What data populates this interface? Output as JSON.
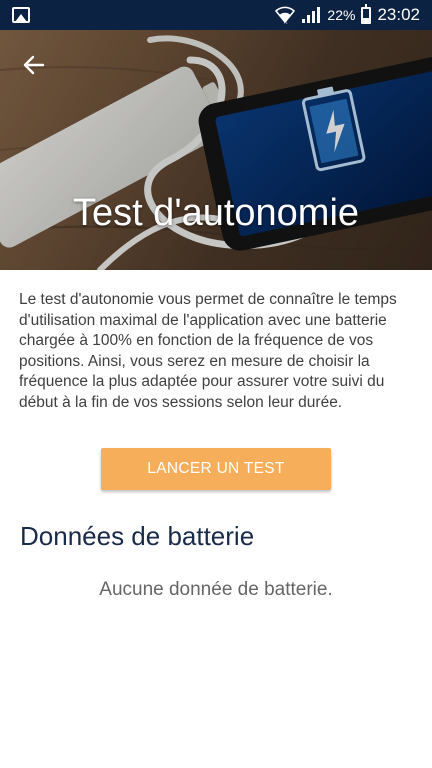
{
  "status_bar": {
    "battery_percent": "22%",
    "time": "23:02"
  },
  "header": {
    "title": "Test d'autonomie"
  },
  "description": "Le test d'autonomie vous permet de connaître le temps d'utilisation maximal de l'application avec une batterie chargée à 100% en fonction de la fréquence de vos positions. Ainsi, vous serez en mesure de choisir la fréquence la plus adaptée pour assurer votre suivi du début à la fin de vos sessions selon leur durée.",
  "actions": {
    "test_button_label": "LANCER UN TEST"
  },
  "battery_data": {
    "section_title": "Données de batterie",
    "empty_message": "Aucune donnée de batterie."
  },
  "colors": {
    "status_bar": "#0c2242",
    "accent_button": "#f6ae5a",
    "section_title": "#1a2a4a"
  },
  "icons": [
    "gallery-icon",
    "wifi-icon",
    "signal-icon",
    "battery-icon",
    "back-arrow-icon"
  ]
}
